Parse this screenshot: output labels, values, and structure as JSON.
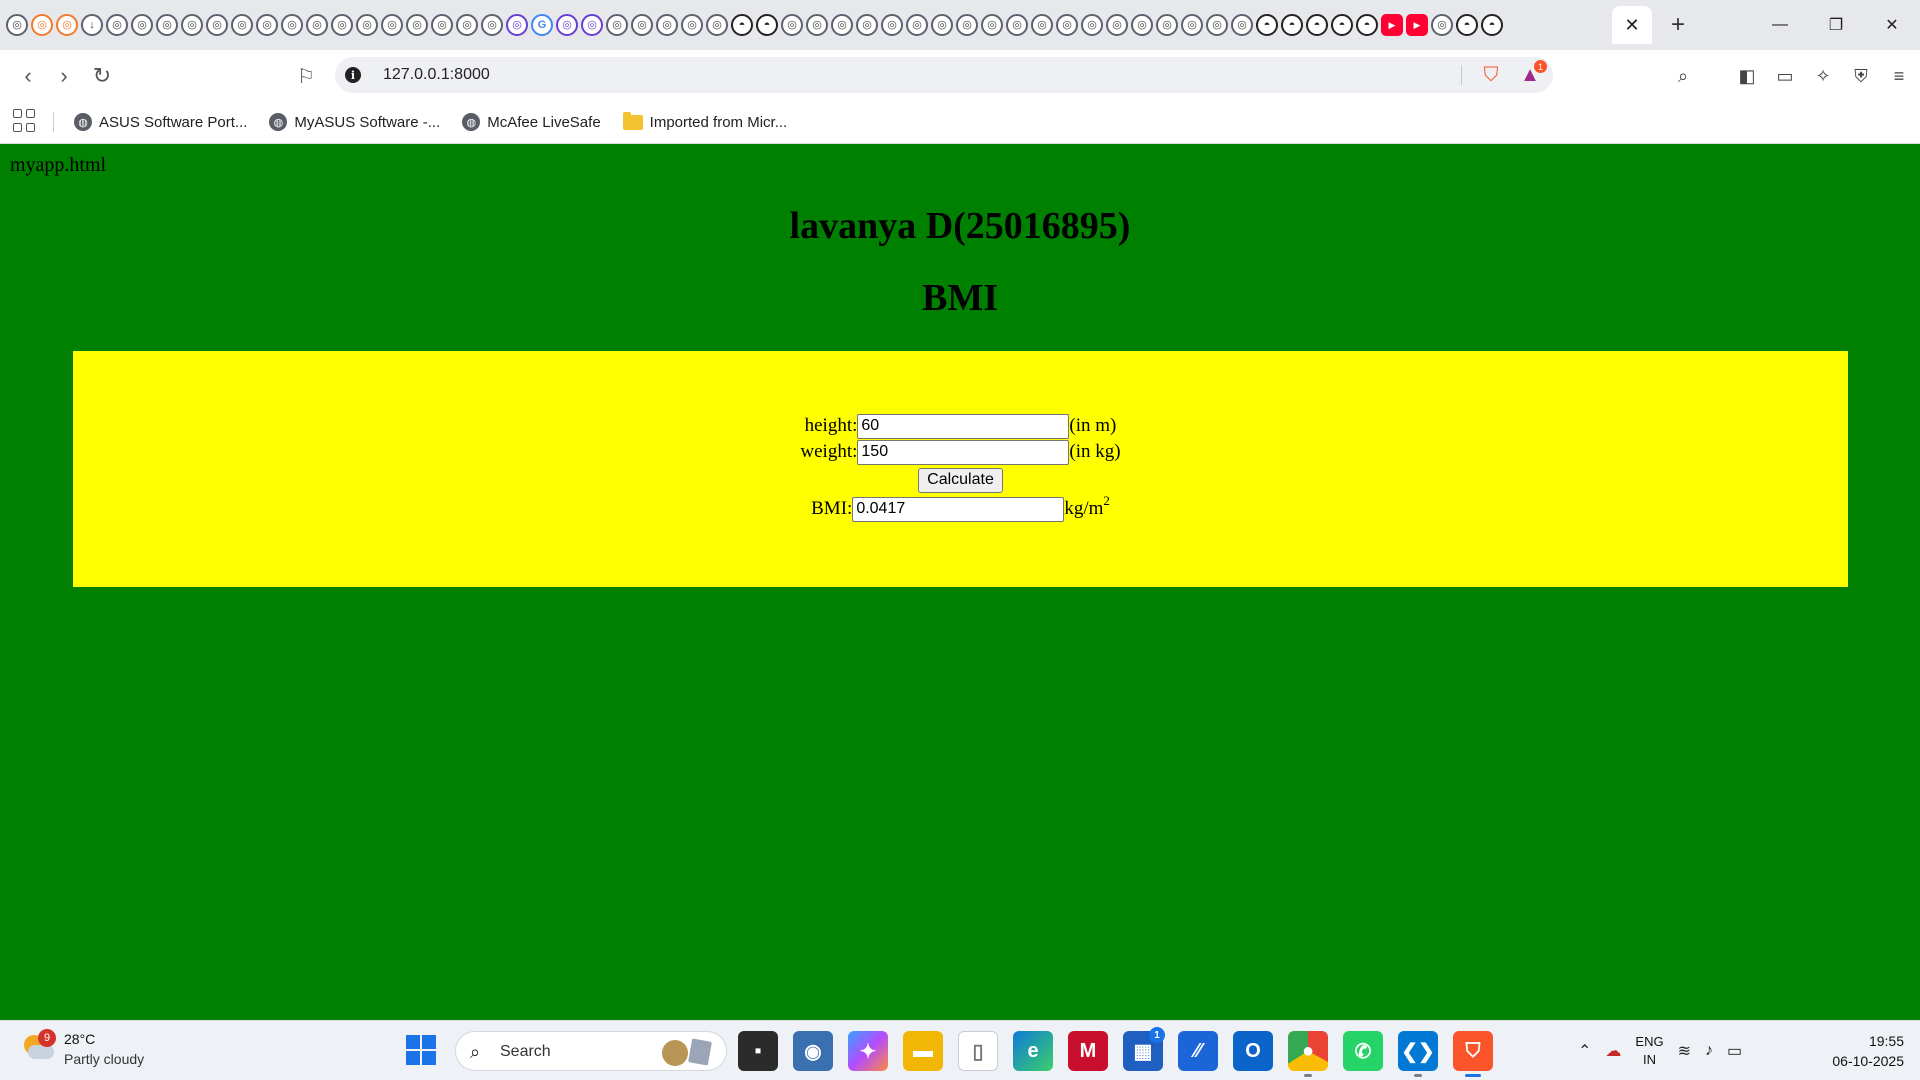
{
  "browser": {
    "tab_favicons": [
      "brave",
      "brave-orange",
      "brave-orange",
      "download",
      "brave",
      "brave",
      "brave",
      "brave",
      "brave",
      "brave",
      "brave",
      "brave",
      "brave",
      "brave",
      "brave",
      "brave",
      "brave",
      "brave",
      "brave",
      "brave",
      "purple",
      "google",
      "purple",
      "purple",
      "brave",
      "brave",
      "brave",
      "brave",
      "brave",
      "github",
      "github",
      "brave",
      "brave",
      "brave",
      "brave",
      "brave",
      "brave",
      "brave",
      "brave",
      "brave",
      "brave",
      "brave",
      "brave",
      "brave",
      "brave",
      "brave",
      "brave",
      "brave",
      "brave",
      "brave",
      "github",
      "github",
      "github",
      "github",
      "github",
      "youtube",
      "youtube",
      "brave",
      "github",
      "github"
    ],
    "active_tab_close": "✕",
    "new_tab": "+",
    "window": {
      "minimize": "—",
      "restore": "❐",
      "close": "✕"
    },
    "url": "127.0.0.1:8000",
    "rewards_badge": "1",
    "bookmarks": [
      {
        "label": "ASUS Software Port...",
        "icon": "globe-icon"
      },
      {
        "label": "MyASUS Software -...",
        "icon": "globe-icon"
      },
      {
        "label": "McAfee LiveSafe",
        "icon": "globe-icon"
      },
      {
        "label": "Imported from Micr...",
        "icon": "folder-icon"
      }
    ]
  },
  "page": {
    "caption": "myapp.html",
    "title": "lavanya D(25016895)",
    "heading": "BMI",
    "form": {
      "height_label": "height:",
      "height_value": "60",
      "height_unit": "(in m)",
      "weight_label": "weight:",
      "weight_value": "150",
      "weight_unit": "(in kg)",
      "calculate_label": "Calculate",
      "bmi_label": "BMI:",
      "bmi_value": "0.0417",
      "bmi_unit": "kg/m",
      "bmi_unit_sup": "2"
    },
    "colors": {
      "background": "#008000",
      "panel": "#ffff00"
    }
  },
  "taskbar": {
    "weather_temp": "28°C",
    "weather_condition": "Partly cloudy",
    "weather_badge": "9",
    "search_label": "Search",
    "store_badge": "1",
    "language_line1": "ENG",
    "language_line2": "IN",
    "time": "19:55",
    "date": "06-10-2025"
  }
}
